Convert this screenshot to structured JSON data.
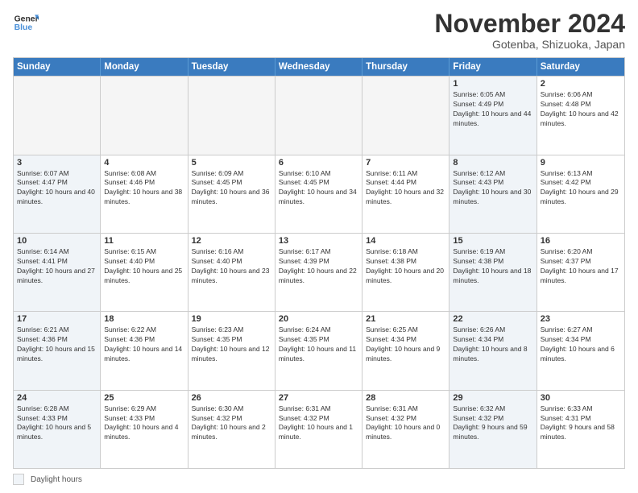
{
  "logo": {
    "line1": "General",
    "line2": "Blue"
  },
  "title": "November 2024",
  "location": "Gotenba, Shizuoka, Japan",
  "days_of_week": [
    "Sunday",
    "Monday",
    "Tuesday",
    "Wednesday",
    "Thursday",
    "Friday",
    "Saturday"
  ],
  "legend_label": "Daylight hours",
  "weeks": [
    [
      {
        "day": "",
        "info": "",
        "empty": true
      },
      {
        "day": "",
        "info": "",
        "empty": true
      },
      {
        "day": "",
        "info": "",
        "empty": true
      },
      {
        "day": "",
        "info": "",
        "empty": true
      },
      {
        "day": "",
        "info": "",
        "empty": true
      },
      {
        "day": "1",
        "info": "Sunrise: 6:05 AM\nSunset: 4:49 PM\nDaylight: 10 hours and 44 minutes.",
        "shaded": true
      },
      {
        "day": "2",
        "info": "Sunrise: 6:06 AM\nSunset: 4:48 PM\nDaylight: 10 hours and 42 minutes.",
        "shaded": false
      }
    ],
    [
      {
        "day": "3",
        "info": "Sunrise: 6:07 AM\nSunset: 4:47 PM\nDaylight: 10 hours and 40 minutes.",
        "shaded": true
      },
      {
        "day": "4",
        "info": "Sunrise: 6:08 AM\nSunset: 4:46 PM\nDaylight: 10 hours and 38 minutes.",
        "shaded": false
      },
      {
        "day": "5",
        "info": "Sunrise: 6:09 AM\nSunset: 4:45 PM\nDaylight: 10 hours and 36 minutes.",
        "shaded": false
      },
      {
        "day": "6",
        "info": "Sunrise: 6:10 AM\nSunset: 4:45 PM\nDaylight: 10 hours and 34 minutes.",
        "shaded": false
      },
      {
        "day": "7",
        "info": "Sunrise: 6:11 AM\nSunset: 4:44 PM\nDaylight: 10 hours and 32 minutes.",
        "shaded": false
      },
      {
        "day": "8",
        "info": "Sunrise: 6:12 AM\nSunset: 4:43 PM\nDaylight: 10 hours and 30 minutes.",
        "shaded": true
      },
      {
        "day": "9",
        "info": "Sunrise: 6:13 AM\nSunset: 4:42 PM\nDaylight: 10 hours and 29 minutes.",
        "shaded": false
      }
    ],
    [
      {
        "day": "10",
        "info": "Sunrise: 6:14 AM\nSunset: 4:41 PM\nDaylight: 10 hours and 27 minutes.",
        "shaded": true
      },
      {
        "day": "11",
        "info": "Sunrise: 6:15 AM\nSunset: 4:40 PM\nDaylight: 10 hours and 25 minutes.",
        "shaded": false
      },
      {
        "day": "12",
        "info": "Sunrise: 6:16 AM\nSunset: 4:40 PM\nDaylight: 10 hours and 23 minutes.",
        "shaded": false
      },
      {
        "day": "13",
        "info": "Sunrise: 6:17 AM\nSunset: 4:39 PM\nDaylight: 10 hours and 22 minutes.",
        "shaded": false
      },
      {
        "day": "14",
        "info": "Sunrise: 6:18 AM\nSunset: 4:38 PM\nDaylight: 10 hours and 20 minutes.",
        "shaded": false
      },
      {
        "day": "15",
        "info": "Sunrise: 6:19 AM\nSunset: 4:38 PM\nDaylight: 10 hours and 18 minutes.",
        "shaded": true
      },
      {
        "day": "16",
        "info": "Sunrise: 6:20 AM\nSunset: 4:37 PM\nDaylight: 10 hours and 17 minutes.",
        "shaded": false
      }
    ],
    [
      {
        "day": "17",
        "info": "Sunrise: 6:21 AM\nSunset: 4:36 PM\nDaylight: 10 hours and 15 minutes.",
        "shaded": true
      },
      {
        "day": "18",
        "info": "Sunrise: 6:22 AM\nSunset: 4:36 PM\nDaylight: 10 hours and 14 minutes.",
        "shaded": false
      },
      {
        "day": "19",
        "info": "Sunrise: 6:23 AM\nSunset: 4:35 PM\nDaylight: 10 hours and 12 minutes.",
        "shaded": false
      },
      {
        "day": "20",
        "info": "Sunrise: 6:24 AM\nSunset: 4:35 PM\nDaylight: 10 hours and 11 minutes.",
        "shaded": false
      },
      {
        "day": "21",
        "info": "Sunrise: 6:25 AM\nSunset: 4:34 PM\nDaylight: 10 hours and 9 minutes.",
        "shaded": false
      },
      {
        "day": "22",
        "info": "Sunrise: 6:26 AM\nSunset: 4:34 PM\nDaylight: 10 hours and 8 minutes.",
        "shaded": true
      },
      {
        "day": "23",
        "info": "Sunrise: 6:27 AM\nSunset: 4:34 PM\nDaylight: 10 hours and 6 minutes.",
        "shaded": false
      }
    ],
    [
      {
        "day": "24",
        "info": "Sunrise: 6:28 AM\nSunset: 4:33 PM\nDaylight: 10 hours and 5 minutes.",
        "shaded": true
      },
      {
        "day": "25",
        "info": "Sunrise: 6:29 AM\nSunset: 4:33 PM\nDaylight: 10 hours and 4 minutes.",
        "shaded": false
      },
      {
        "day": "26",
        "info": "Sunrise: 6:30 AM\nSunset: 4:32 PM\nDaylight: 10 hours and 2 minutes.",
        "shaded": false
      },
      {
        "day": "27",
        "info": "Sunrise: 6:31 AM\nSunset: 4:32 PM\nDaylight: 10 hours and 1 minute.",
        "shaded": false
      },
      {
        "day": "28",
        "info": "Sunrise: 6:31 AM\nSunset: 4:32 PM\nDaylight: 10 hours and 0 minutes.",
        "shaded": false
      },
      {
        "day": "29",
        "info": "Sunrise: 6:32 AM\nSunset: 4:32 PM\nDaylight: 9 hours and 59 minutes.",
        "shaded": true
      },
      {
        "day": "30",
        "info": "Sunrise: 6:33 AM\nSunset: 4:31 PM\nDaylight: 9 hours and 58 minutes.",
        "shaded": false
      }
    ]
  ]
}
